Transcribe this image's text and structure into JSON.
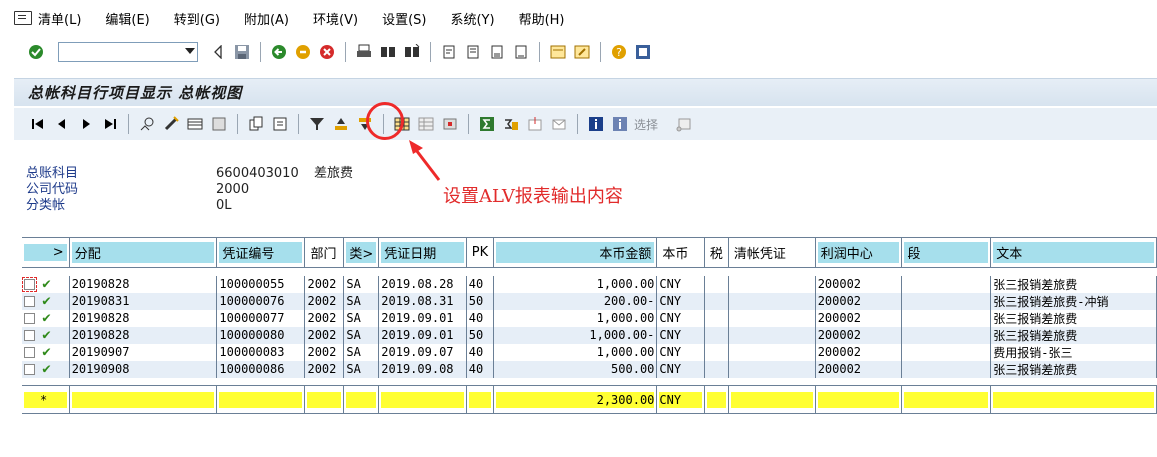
{
  "menu": {
    "items": [
      {
        "label": "清单(L)"
      },
      {
        "label": "编辑(E)"
      },
      {
        "label": "转到(G)"
      },
      {
        "label": "附加(A)"
      },
      {
        "label": "环境(V)"
      },
      {
        "label": "设置(S)"
      },
      {
        "label": "系统(Y)"
      },
      {
        "label": "帮助(H)"
      }
    ]
  },
  "command_field": {
    "value": ""
  },
  "page_title": "总帐科目行项目显示 总帐视图",
  "app_toolbar": {
    "select_label": "选择"
  },
  "header_info": [
    {
      "label": "总账科目",
      "value": "6600403010",
      "value2": "差旅费"
    },
    {
      "label": "公司代码",
      "value": "2000",
      "value2": ""
    },
    {
      "label": "分类帐",
      "value": "0L",
      "value2": ""
    }
  ],
  "annotation": "设置ALV报表输出内容",
  "table": {
    "columns": [
      ">",
      "分配",
      "凭证编号",
      "部门",
      "类>",
      "凭证日期",
      "PK",
      "本币金额",
      "本币",
      "税",
      "清帐凭证",
      "利润中心",
      "段",
      "文本"
    ],
    "rows": [
      {
        "assign": "20190828",
        "doc_no": "100000055",
        "dept": "2002",
        "type": "SA",
        "date": "2019.08.28",
        "pk": "40",
        "amount": "1,000.00",
        "cur": "CNY",
        "tax": "",
        "clr": "",
        "profit": "200002",
        "seg": "",
        "text": "张三报销差旅费"
      },
      {
        "assign": "20190831",
        "doc_no": "100000076",
        "dept": "2002",
        "type": "SA",
        "date": "2019.08.31",
        "pk": "50",
        "amount": "200.00-",
        "cur": "CNY",
        "tax": "",
        "clr": "",
        "profit": "200002",
        "seg": "",
        "text": "张三报销差旅费-冲销"
      },
      {
        "assign": "20190828",
        "doc_no": "100000077",
        "dept": "2002",
        "type": "SA",
        "date": "2019.09.01",
        "pk": "40",
        "amount": "1,000.00",
        "cur": "CNY",
        "tax": "",
        "clr": "",
        "profit": "200002",
        "seg": "",
        "text": "张三报销差旅费"
      },
      {
        "assign": "20190828",
        "doc_no": "100000080",
        "dept": "2002",
        "type": "SA",
        "date": "2019.09.01",
        "pk": "50",
        "amount": "1,000.00-",
        "cur": "CNY",
        "tax": "",
        "clr": "",
        "profit": "200002",
        "seg": "",
        "text": "张三报销差旅费"
      },
      {
        "assign": "20190907",
        "doc_no": "100000083",
        "dept": "2002",
        "type": "SA",
        "date": "2019.09.07",
        "pk": "40",
        "amount": "1,000.00",
        "cur": "CNY",
        "tax": "",
        "clr": "",
        "profit": "200002",
        "seg": "",
        "text": "费用报销-张三"
      },
      {
        "assign": "20190908",
        "doc_no": "100000086",
        "dept": "2002",
        "type": "SA",
        "date": "2019.09.08",
        "pk": "40",
        "amount": "500.00",
        "cur": "CNY",
        "tax": "",
        "clr": "",
        "profit": "200002",
        "seg": "",
        "text": "张三报销差旅费"
      }
    ],
    "total": {
      "marker": "*",
      "amount": "2,300.00",
      "cur": "CNY"
    }
  },
  "colors": {
    "header_cell": "#a6dfec",
    "total_highlight": "#ffff33",
    "annotation": "#e12b2b",
    "title_band": "#d7e3ef"
  },
  "icons": [
    "enter-icon",
    "save-icon",
    "back-icon",
    "exit-icon",
    "cancel-icon",
    "print-icon",
    "find-icon",
    "find-next-icon",
    "first-page-icon",
    "prev-page-icon",
    "next-page-icon",
    "last-page-icon",
    "change-layout-icon",
    "filter-icon",
    "sort-ascending-icon",
    "sort-descending-icon",
    "sum-icon",
    "subtotal-icon",
    "info-icon",
    "help-icon"
  ]
}
